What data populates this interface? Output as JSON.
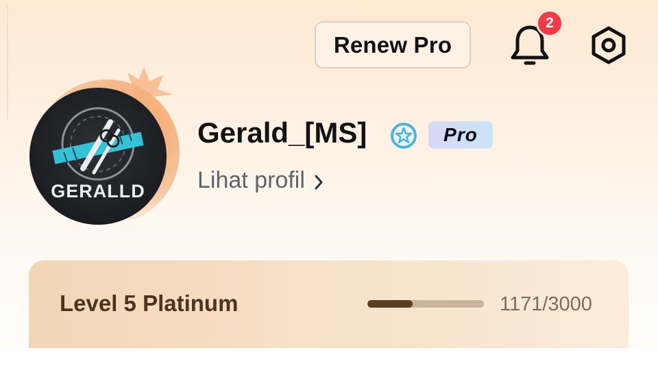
{
  "header": {
    "renew_label": "Renew Pro",
    "notification_count": "2"
  },
  "profile": {
    "avatar_text": "GERALLD",
    "username": "Gerald_[MS]",
    "pro_label": "Pro",
    "view_profile_label": "Lihat profil"
  },
  "level": {
    "title": "Level 5 Platinum",
    "current": 1171,
    "target": 3000,
    "progress_text": "1171/3000"
  },
  "colors": {
    "badge": "#f23b46",
    "verified": "#4fb3d9",
    "progress_fill": "#5a3d22",
    "progress_track": "#c9b59d",
    "level_text": "#4a3420"
  },
  "icons": {
    "notification": "bell-icon",
    "settings": "settings-hex-icon",
    "verified": "verified-star-icon",
    "chevron": "chevron-right-icon"
  }
}
